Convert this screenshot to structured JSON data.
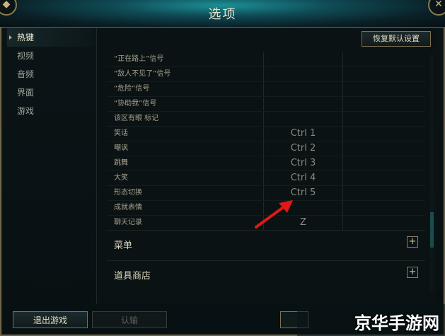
{
  "window": {
    "title": "选项"
  },
  "sidebar": {
    "items": [
      {
        "label": "热键"
      },
      {
        "label": "视频"
      },
      {
        "label": "音频"
      },
      {
        "label": "界面"
      },
      {
        "label": "游戏"
      }
    ]
  },
  "panel": {
    "reset_label": "恢复默认设置",
    "rows": [
      {
        "action": "“正在路上”信号",
        "key": ""
      },
      {
        "action": "“敌人不见了”信号",
        "key": ""
      },
      {
        "action": "“危险”信号",
        "key": ""
      },
      {
        "action": "“协助我”信号",
        "key": ""
      },
      {
        "action": "该区有眼 标记",
        "key": ""
      },
      {
        "action": "笑话",
        "key": "Ctrl 1"
      },
      {
        "action": "嘲讽",
        "key": "Ctrl 2"
      },
      {
        "action": "跳舞",
        "key": "Ctrl 3"
      },
      {
        "action": "大笑",
        "key": "Ctrl 4"
      },
      {
        "action": "形态切换",
        "key": "Ctrl 5"
      },
      {
        "action": "成就表情",
        "key": ""
      },
      {
        "action": "聊天记录",
        "key": "Z"
      }
    ],
    "sections": [
      {
        "label": "菜单"
      },
      {
        "label": "道具商店"
      }
    ]
  },
  "footer": {
    "quit_label": "退出游戏",
    "surrender_label": "认输"
  },
  "watermark": {
    "text": "京华手游网"
  },
  "colors": {
    "accent": "#c8aa6e",
    "arrow": "#e01818",
    "header_glow": "#1c8f95"
  }
}
